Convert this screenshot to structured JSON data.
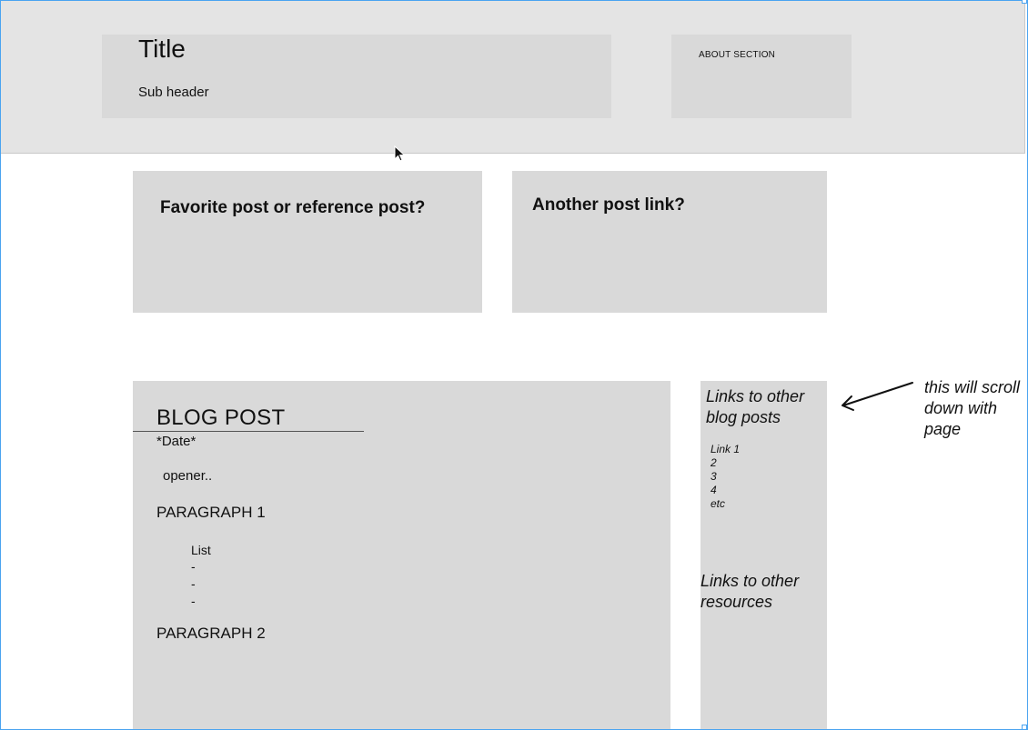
{
  "header": {
    "title": "Title",
    "subheader": "Sub header",
    "about_label": "ABOUT SECTION"
  },
  "featured": {
    "favorite_label": "Favorite post or reference post?",
    "another_label": "Another post link?"
  },
  "blog_post": {
    "title": "BLOG POST",
    "date": "*Date*",
    "opener": "opener..",
    "paragraph_1": "PARAGRAPH 1",
    "list_label": "List",
    "list_items": [
      "-",
      "-",
      "-"
    ],
    "paragraph_2": "PARAGRAPH 2"
  },
  "sidebar": {
    "blog_links_heading": "Links to other blog posts",
    "links": [
      "Link 1",
      "2",
      "3",
      "4",
      "etc"
    ],
    "resources_heading": "Links to other resources"
  },
  "annotation": {
    "note": "this will scroll down with page"
  },
  "colors": {
    "header_bg": "#e4e4e4",
    "block_bg": "#d9d9d9",
    "frame_selection": "#4aa3f0"
  }
}
